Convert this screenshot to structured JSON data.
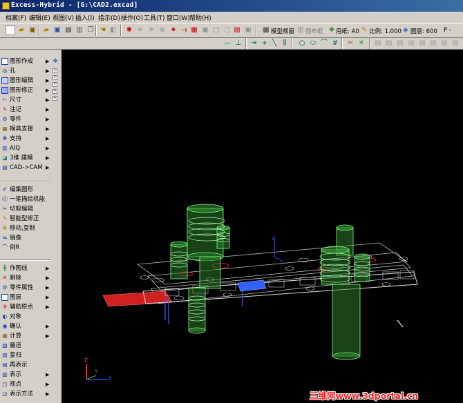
{
  "window": {
    "title": "Excess-Hybrid - [G:\\CAD2.excad]"
  },
  "menu": [
    "档案(F)",
    "编辑(E)",
    "视图(V)",
    "插入(I)",
    "指示(D)",
    "操作(O)",
    "工具(T)",
    "窗口(W)",
    "帮助(H)"
  ],
  "toolbar": {
    "model_view": "模型视窗",
    "figure_frame": "图布框",
    "paper_label": "用纸: A0",
    "scale_label": "比例: 1.000",
    "layer_label": "图层: 600",
    "extra_label": "P -"
  },
  "sidebar": {
    "group1": [
      "图形作成",
      "孔",
      "图形编辑",
      "图形修正",
      "尺寸",
      "注记",
      "零件",
      "模具支援",
      "支持",
      "AIQ",
      "3维 建模",
      "CAD->CAM"
    ],
    "group2": [
      "编集图形",
      "一笔描绘机能",
      "切取编辑",
      "智能型修正",
      "移动,复制",
      "镜像",
      "倒R"
    ],
    "group3": [
      "作图线",
      "删除",
      "零件属性",
      "图层",
      "辅助原点",
      "对象",
      "确认",
      "计算",
      "最适",
      "复归",
      "再表示",
      "表示",
      "视点",
      "表示方法"
    ]
  },
  "viewport": {
    "axis_labels": [
      "Z",
      "Y",
      "X"
    ]
  },
  "watermark": "三维网www.3dportal.cn",
  "colors": {
    "title_start": "#0a246a",
    "title_end": "#3a6ea5",
    "model_green": "#7fff7f",
    "strip_red": "#d02020",
    "strip_blue": "#3060ff"
  }
}
